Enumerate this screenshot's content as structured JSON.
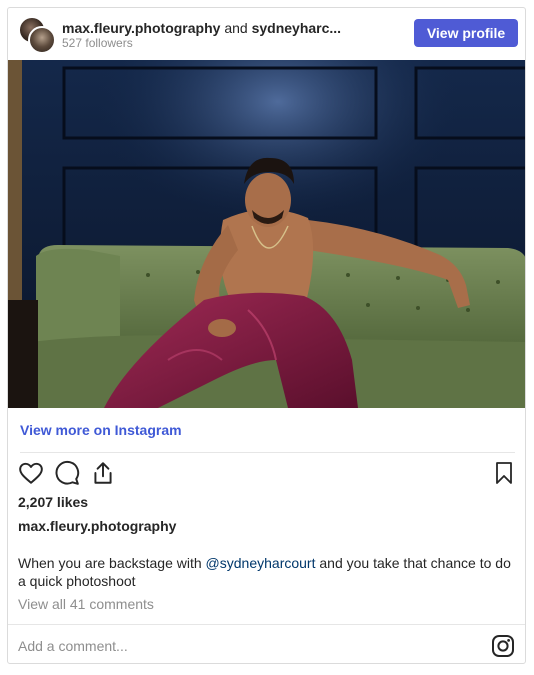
{
  "header": {
    "owner": "max.fleury.photography",
    "conjunction": "and",
    "collaborator": "sydneyharc...",
    "followers": "527 followers",
    "view_profile_label": "View profile"
  },
  "post": {
    "view_more_label": "View more on Instagram",
    "likes": "2,207 likes",
    "caption_user": "max.fleury.photography",
    "caption_before": "When you are backstage with ",
    "caption_mention": "@sydneyharcourt",
    "caption_after": " and you take that chance to do a quick photoshoot",
    "view_comments": "View all 41 comments"
  },
  "footer": {
    "add_comment_placeholder": "Add a comment..."
  },
  "icons": {
    "like": "heart-icon",
    "comment": "comment-icon",
    "share": "share-icon",
    "save": "bookmark-icon",
    "instagram": "instagram-icon"
  },
  "colors": {
    "button": "#4f5bd5",
    "link": "#3f59d6",
    "mention": "#00376b",
    "muted": "#8e8e8e"
  }
}
